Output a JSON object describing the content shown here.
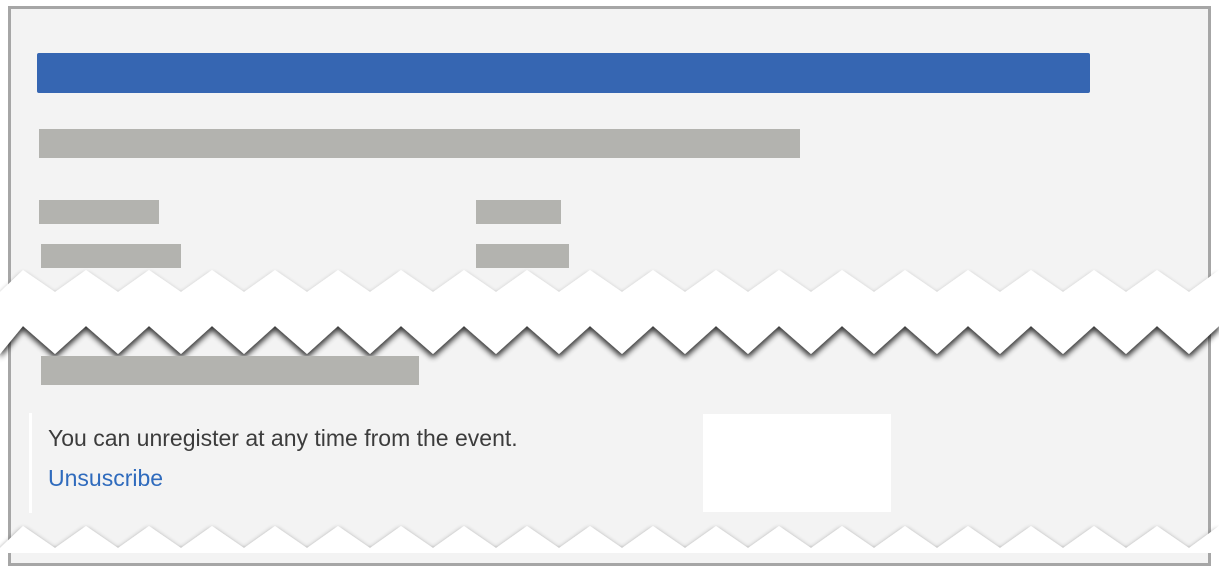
{
  "notice": {
    "message": "You can unregister at any time from the event.",
    "unsubscribe_label": "Unsuscribe"
  },
  "colors": {
    "header_bar": "#3666b2",
    "placeholder_bar": "#b3b3af",
    "link": "#2f6bbd",
    "text": "#3c3c3c",
    "background": "#f3f3f3"
  }
}
